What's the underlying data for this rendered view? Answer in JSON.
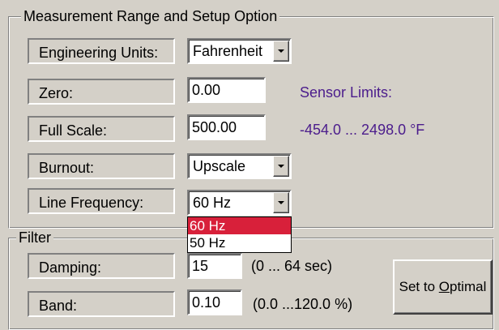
{
  "setup_group": {
    "title": "Measurement Range and Setup Option",
    "engineering_units": {
      "label": "Engineering Units:",
      "value": "Fahrenheit"
    },
    "zero": {
      "label": "Zero:",
      "value": "0.00"
    },
    "full_scale": {
      "label": "Full Scale:",
      "value": "500.00"
    },
    "burnout": {
      "label": "Burnout:",
      "value": "Upscale"
    },
    "line_frequency": {
      "label": "Line Frequency:",
      "value": "60 Hz",
      "options": [
        "60 Hz",
        "50 Hz"
      ]
    },
    "sensor_limits_label": "Sensor Limits:",
    "sensor_limits_value": "-454.0 ... 2498.0 °F"
  },
  "filter_group": {
    "title": "Filter",
    "damping": {
      "label": "Damping:",
      "value": "15",
      "range": "(0 ... 64 sec)"
    },
    "band": {
      "label": "Band:",
      "value": "0.10",
      "range": "(0.0 ...120.0 %)"
    },
    "optimal_button_pre": "Set to ",
    "optimal_button_accel": "O",
    "optimal_button_post": "ptimal"
  },
  "colors": {
    "dialog_bg": "#d4d0c8",
    "info_text": "#4b1c8c",
    "selection": "#d8203a"
  },
  "icons": {
    "combo_arrow": "chevron-down-icon"
  }
}
